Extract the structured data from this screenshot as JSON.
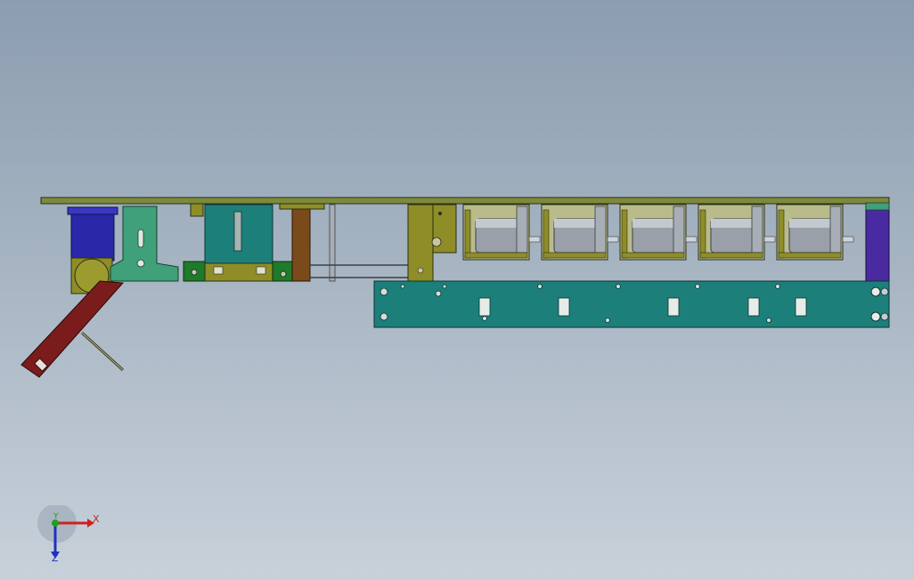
{
  "colors": {
    "background_top": "#8c9db0",
    "background_bottom": "#c8d1da",
    "top_rail": "#7d8a3c",
    "front_panel": "#1d7f7a",
    "motor_block": "#2a28a8",
    "olive_parts": "#8e8d28",
    "arm": "#7a1c1c",
    "solenoid_body": "#9aa0aa",
    "right_endcap": "#4a2aa0",
    "axis_x": "#d02020",
    "axis_y": "#20a020",
    "axis_z": "#2030c0"
  },
  "triad": {
    "x_label": "X",
    "y_label": "Y",
    "z_label": "Z"
  },
  "solenoid_count": 5
}
